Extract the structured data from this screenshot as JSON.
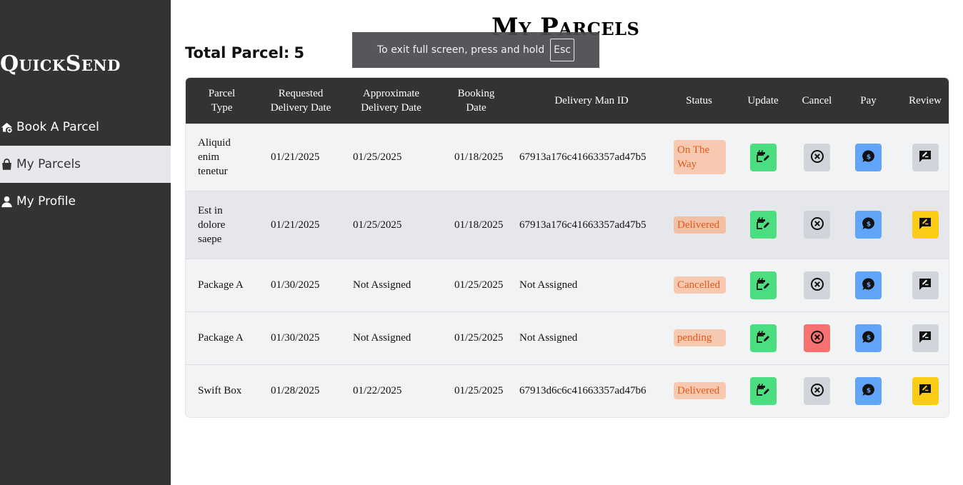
{
  "app": {
    "brand": "QuickSend"
  },
  "sidebar": {
    "items": [
      {
        "label": "Book A Parcel",
        "icon": "home-plus-icon",
        "active": false
      },
      {
        "label": "My Parcels",
        "icon": "shopping-bag-icon",
        "active": true
      },
      {
        "label": "My Profile",
        "icon": "user-icon",
        "active": false
      }
    ]
  },
  "page": {
    "title": "My Parcels",
    "total_label": "Total Parcel:",
    "total_count": "5"
  },
  "toast": {
    "text": "To exit full screen, press and hold",
    "key": "Esc"
  },
  "colors": {
    "sidebar_bg": "#333333",
    "update": "#4ade80",
    "cancel": "#d1d5db",
    "cancel_active": "#f87171",
    "pay": "#60a5fa",
    "review": "#d1d5db",
    "review_active": "#facc15",
    "status_bg": "#f7c9b1",
    "status_text": "#e05a1a"
  },
  "table": {
    "headers": {
      "type_1": "Parcel",
      "type_2": "Type",
      "req_1": "Requested",
      "req_2": "Delivery Date",
      "apx_1": "Approximate",
      "apx_2": "Delivery Date",
      "book_1": "Booking",
      "book_2": "Date",
      "dm": "Delivery Man ID",
      "status": "Status",
      "update": "Update",
      "cancel": "Cancel",
      "pay": "Pay",
      "review": "Review"
    },
    "rows": [
      {
        "type_1": "Aliquid",
        "type_2": "enim",
        "type_3": "tenetur",
        "requested": "01/21/2025",
        "approximate": "01/25/2025",
        "booking": "01/18/2025",
        "delivery_man": "67913a176c41663357ad47b5",
        "status_1": "On The",
        "status_2": "Way",
        "cancel_active": false,
        "review_active": false
      },
      {
        "type_1": "Est in",
        "type_2": "dolore",
        "type_3": "saepe",
        "requested": "01/21/2025",
        "approximate": "01/25/2025",
        "booking": "01/18/2025",
        "delivery_man": "67913a176c41663357ad47b5",
        "status": "Delivered",
        "cancel_active": false,
        "review_active": true
      },
      {
        "type": "Package A",
        "requested": "01/30/2025",
        "approximate": "Not Assigned",
        "booking": "01/25/2025",
        "delivery_man": "Not Assigned",
        "status": "Cancelled",
        "cancel_active": false,
        "review_active": false
      },
      {
        "type": "Package A",
        "requested": "01/30/2025",
        "approximate": "Not Assigned",
        "booking": "01/25/2025",
        "delivery_man": "Not Assigned",
        "status": "pending",
        "cancel_active": true,
        "review_active": false
      },
      {
        "type": "Swift Box",
        "requested": "01/28/2025",
        "approximate": "01/22/2025",
        "booking": "01/25/2025",
        "delivery_man": "67913d6c6c41663357ad47b6",
        "status": "Delivered",
        "cancel_active": false,
        "review_active": true
      }
    ]
  }
}
